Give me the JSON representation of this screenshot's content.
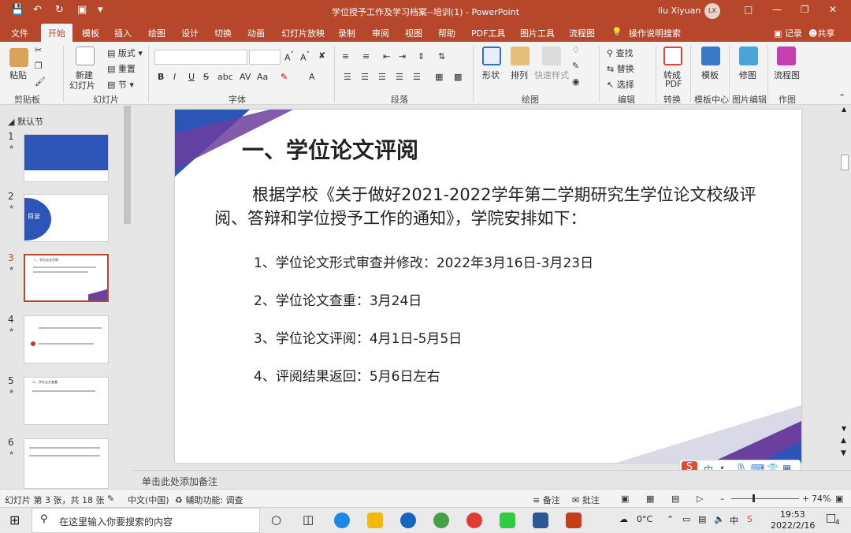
{
  "titlebar": {
    "document_title": "学位授予工作及学习档案--培训(1) - PowerPoint",
    "user": "liu Xiyuan",
    "avatar": "LX"
  },
  "tabs": [
    "文件",
    "开始",
    "模板",
    "插入",
    "绘图",
    "设计",
    "切换",
    "动画",
    "幻灯片放映",
    "录制",
    "审阅",
    "视图",
    "帮助",
    "PDF工具",
    "图片工具",
    "流程图"
  ],
  "active_tab": "开始",
  "tell_me": "操作说明搜索",
  "record": "记录",
  "share": "共享",
  "ribbon": {
    "clipboard": {
      "paste": "粘贴",
      "group": "剪贴板"
    },
    "slides": {
      "new_slide_1": "新建",
      "new_slide_2": "幻灯片",
      "layout": "版式",
      "reset": "重置",
      "section": "节",
      "group": "幻灯片"
    },
    "font": {
      "group": "字体"
    },
    "paragraph": {
      "group": "段落"
    },
    "drawing": {
      "shape": "形状",
      "arrange": "排列",
      "quick_styles": "快速样式",
      "group": "绘图"
    },
    "editing": {
      "find": "查找",
      "replace": "替换",
      "select": "选择",
      "group": "编辑"
    },
    "convert": {
      "label_1": "转成",
      "label_2": "PDF",
      "group": "转换"
    },
    "template_center": {
      "label": "模板",
      "group": "模板中心"
    },
    "image_edit": {
      "label": "修图",
      "group": "图片编辑"
    },
    "work": {
      "label": "流程图",
      "group": "作图"
    }
  },
  "panel": {
    "section": "默认节",
    "slides": [
      "1",
      "2",
      "3",
      "4",
      "5",
      "6"
    ],
    "selected": "3"
  },
  "thumbs": {
    "t2_title": "目录",
    "t3_title": "一、学位论文评阅",
    "t5_title": "二、学位论文查重"
  },
  "slide": {
    "title": "一、学位论文评阅",
    "intro": "根据学校《关于做好2021-2022学年第二学期研究生学位论文校级评阅、答辩和学位授予工作的通知》，学院安排如下：",
    "items": [
      "1、学位论文形式审查并修改：2022年3月16日-3月23日",
      "2、学位论文查重：3月24日",
      "3、学位论文评阅：4月1日-5月5日",
      "4、评阅结果返回：5月6日左右"
    ]
  },
  "notes_placeholder": "单击此处添加备注",
  "status": {
    "slide_count": "幻灯片 第 3 张，共 18 张",
    "language": "中文(中国)",
    "accessibility": "辅助功能: 调查",
    "notes": "备注",
    "comments": "批注",
    "zoom": "74%"
  },
  "ime": {
    "lang": "中"
  },
  "taskbar": {
    "search_placeholder": "在这里输入你要搜索的内容",
    "weather": "0°C",
    "time": "19:53",
    "date": "2022/2/16",
    "notification_count": "4"
  },
  "colors": {
    "accent": "#b7472a",
    "slide_blue": "#2d55b8",
    "slide_purple": "#6b3f9e"
  }
}
